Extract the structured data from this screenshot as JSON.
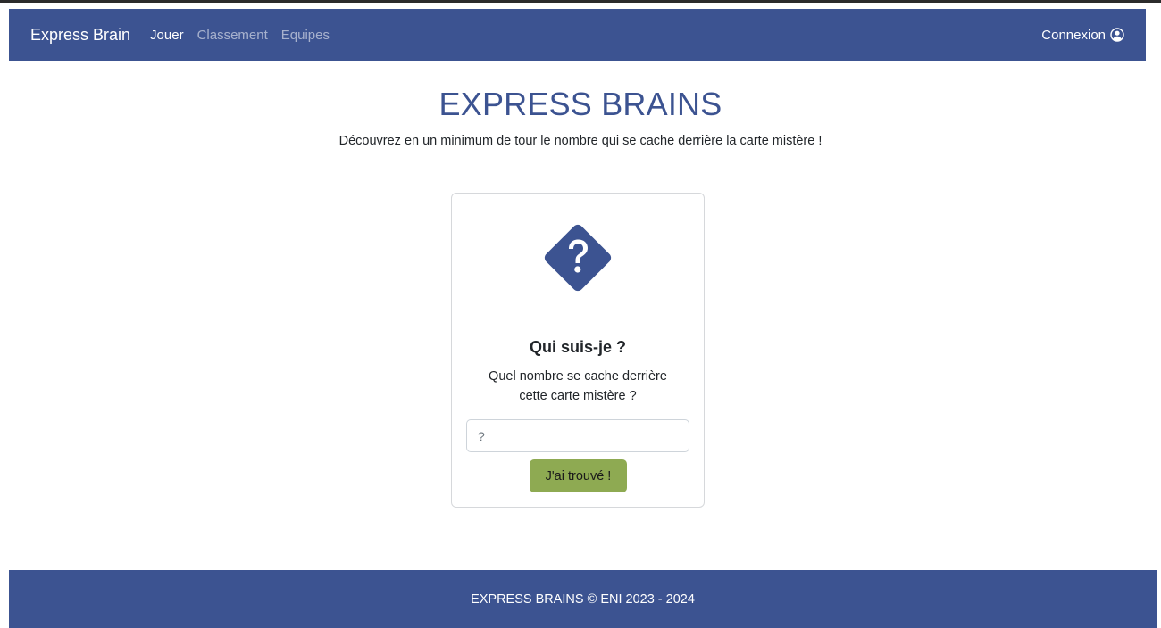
{
  "navbar": {
    "brand": "Express Brain",
    "links": [
      {
        "label": "Jouer",
        "active": true
      },
      {
        "label": "Classement",
        "active": false
      },
      {
        "label": "Equipes",
        "active": false
      }
    ],
    "login_label": "Connexion",
    "login_icon": "user-circle-icon",
    "bg_color": "#3c5391"
  },
  "hero": {
    "title": "EXPRESS BRAINS",
    "subtitle": "Découvrez en un minimum de tour le nombre qui se cache derrière la carte mistère !"
  },
  "card": {
    "icon": "question-diamond-icon",
    "title": "Qui suis-je ?",
    "text_line1": "Quel nombre se cache derrière",
    "text_line2": "cette carte mistère ?",
    "input_placeholder": "?",
    "input_value": "",
    "button_label": "J'ai trouvé !",
    "button_color": "#8eaa52"
  },
  "footer": {
    "text": "EXPRESS BRAINS © ENI 2023 - 2024"
  }
}
